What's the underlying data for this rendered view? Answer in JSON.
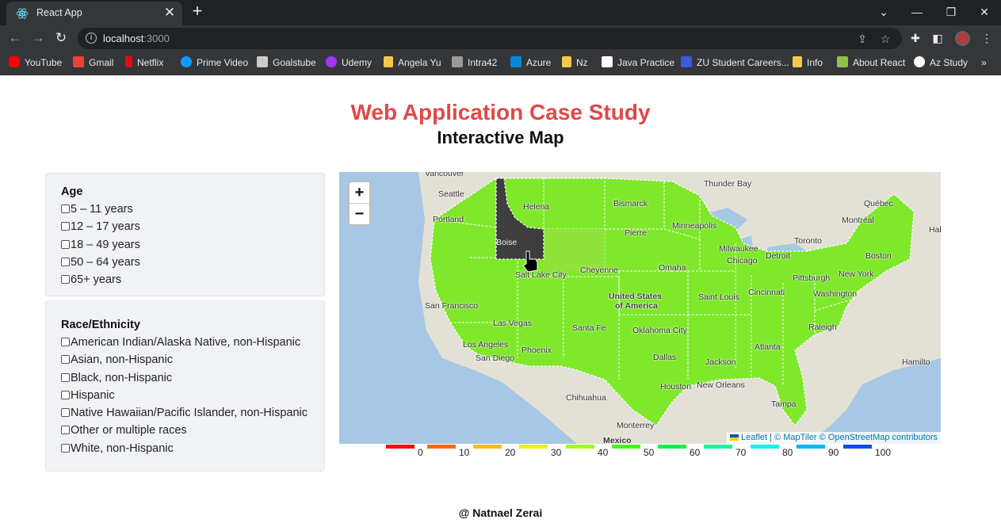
{
  "browser": {
    "tab_title": "React App",
    "url_host": "localhost",
    "url_port": ":3000",
    "bookmarks": [
      {
        "label": "YouTube",
        "icon": "youtube-icon",
        "color": "#ff0000"
      },
      {
        "label": "Gmail",
        "icon": "gmail-icon",
        "color": "#ea4335"
      },
      {
        "label": "Netflix",
        "icon": "netflix-icon",
        "color": "#e50914"
      },
      {
        "label": "Prime Video",
        "icon": "prime-video-icon",
        "color": "#1399ff"
      },
      {
        "label": "Goalstube",
        "icon": "goalstube-icon",
        "color": "#cccccc"
      },
      {
        "label": "Udemy",
        "icon": "udemy-icon",
        "color": "#a435f0"
      },
      {
        "label": "Angela Yu",
        "icon": "folder-icon",
        "color": "#f2c94c"
      },
      {
        "label": "Intra42",
        "icon": "intra42-icon",
        "color": "#cccccc"
      },
      {
        "label": "Azure",
        "icon": "azure-icon",
        "color": "#0089d6"
      },
      {
        "label": "Nz",
        "icon": "folder-icon",
        "color": "#f2c94c"
      },
      {
        "label": "Java Practice",
        "icon": "w3schools-icon",
        "color": "#ffffff"
      },
      {
        "label": "ZU Student Careers...",
        "icon": "zu-icon",
        "color": "#3b5bdb"
      },
      {
        "label": "Info",
        "icon": "folder-icon",
        "color": "#f2c94c"
      },
      {
        "label": "About React",
        "icon": "about-react-icon",
        "color": "#8bc34a"
      },
      {
        "label": "Az Study",
        "icon": "github-icon",
        "color": "#ffffff"
      }
    ]
  },
  "page": {
    "title": "Web Application Case Study",
    "subtitle": "Interactive Map",
    "footer": "@ Natnael Zerai"
  },
  "filters": {
    "age": {
      "heading": "Age",
      "options": [
        "5 – 11 years",
        "12 – 17 years",
        "18 – 49 years",
        "50 – 64 years",
        "65+ years"
      ]
    },
    "race": {
      "heading": "Race/Ethnicity",
      "options": [
        "American Indian/Alaska Native, non-Hispanic",
        "Asian, non-Hispanic",
        "Black, non-Hispanic",
        "Hispanic",
        "Native Hawaiian/Pacific Islander, non-Hispanic",
        "Other or multiple races",
        "White, non-Hispanic"
      ]
    }
  },
  "map": {
    "zoom_in": "+",
    "zoom_out": "−",
    "attribution_leaflet": "Leaflet",
    "attribution_rest": "| © MapTiler © OpenStreetMap contributors",
    "labels": {
      "vancouver": "Vancouver",
      "seattle": "Seattle",
      "portland": "Portland",
      "helena": "Helena",
      "bismarck": "Bismarck",
      "thunder_bay": "Thunder Bay",
      "quebec": "Québec",
      "montreal": "Montréal",
      "halifax": "Hal",
      "minneapolis": "Minneapolis",
      "pierre": "Pierre",
      "toronto": "Toronto",
      "milwaukee": "Milwaukee",
      "detroit": "Detroit",
      "chicago": "Chicago",
      "boston": "Boston",
      "boise": "Boise",
      "salt_lake_city": "Salt Lake City",
      "cheyenne": "Cheyenne",
      "omaha": "Omaha",
      "pittsburgh": "Pittsburgh",
      "new_york": "New York",
      "san_francisco": "San Francisco",
      "united_states_1": "United States",
      "united_states_2": "of America",
      "cincinnati": "Cincinnati",
      "washington": "Washington",
      "saint_louis": "Saint Louis",
      "las_vegas": "Las Vegas",
      "santa_fe": "Santa Fe",
      "oklahoma_city": "Oklahoma City",
      "raleigh": "Raleigh",
      "los_angeles": "Los Angeles",
      "san_diego": "San Diego",
      "phoenix": "Phoenix",
      "atlanta": "Atlanta",
      "dallas": "Dallas",
      "jackson": "Jackson",
      "hamilton": "Hamilto",
      "chihuahua": "Chihuahua",
      "houston": "Houston",
      "new_orleans": "New Orleans",
      "tampa": "Tampa",
      "monterrey": "Monterrey",
      "mexico": "Mexico"
    },
    "colors": {
      "water": "#a7c7e4",
      "land": "#e3e1d6",
      "state_green": "#7fe82b",
      "state_green_alt": "#8fe33a",
      "highlight": "#3e3e3e"
    }
  },
  "legend": {
    "items": [
      {
        "label": "0",
        "color": "#ff0a0a"
      },
      {
        "label": "10",
        "color": "#ff6a10"
      },
      {
        "label": "20",
        "color": "#ffb81a"
      },
      {
        "label": "30",
        "color": "#ecf226"
      },
      {
        "label": "40",
        "color": "#9dfc1f"
      },
      {
        "label": "50",
        "color": "#41fb1a"
      },
      {
        "label": "60",
        "color": "#11f04a"
      },
      {
        "label": "70",
        "color": "#16f59e"
      },
      {
        "label": "80",
        "color": "#17f2e7"
      },
      {
        "label": "90",
        "color": "#0ab5f5"
      },
      {
        "label": "100",
        "color": "#0a4cf2"
      }
    ]
  }
}
